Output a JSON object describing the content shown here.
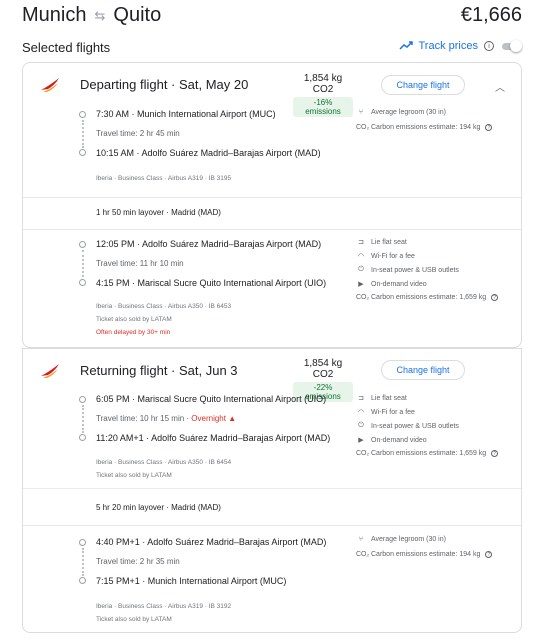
{
  "header": {
    "origin": "Munich",
    "destination": "Quito",
    "swap_icon": "swap-arrows-icon",
    "price": "€1,666"
  },
  "selected_title": "Selected flights",
  "track_prices": {
    "label": "Track prices",
    "info": "i",
    "toggle_on": false
  },
  "colors": {
    "accent": "#1a73e8",
    "logo_red": "#d71920",
    "logo_orange": "#f9a01b",
    "warning": "#d93025",
    "green": "#137333"
  },
  "change_label": "Change flight",
  "departing": {
    "title": "Departing flight · Sat, May 20",
    "co2": "1,854 kg CO2",
    "emissions_badge": "-16% emissions",
    "legs": [
      {
        "dep": "7:30 AM · Munich International Airport (MUC)",
        "travel": "Travel time: 2 hr 45 min",
        "arr": "10:15 AM · Adolfo Suárez Madrid–Barajas Airport (MAD)",
        "details": "Iberia · Business Class · Airbus A319 · IB 3195",
        "amenities": [
          "Average legroom (30 in)",
          "Carbon emissions estimate: 194 kg"
        ]
      },
      {
        "dep": "12:05 PM · Adolfo Suárez Madrid–Barajas Airport (MAD)",
        "travel": "Travel time: 11 hr 10 min",
        "arr": "4:15 PM · Mariscal Sucre Quito International Airport (UIO)",
        "details": "Iberia · Business Class · Airbus A350 · IB 6453",
        "sold_by": "Ticket also sold by LATAM",
        "delay": "Often delayed by 30+ min",
        "amenities": [
          "Lie flat seat",
          "Wi-Fi for a fee",
          "In-seat power & USB outlets",
          "On-demand video",
          "Carbon emissions estimate: 1,659 kg"
        ]
      }
    ],
    "layover": "1 hr 50 min layover · Madrid (MAD)"
  },
  "returning": {
    "title": "Returning flight · Sat, Jun 3",
    "co2": "1,854 kg CO2",
    "emissions_badge": "-22% emissions",
    "legs": [
      {
        "dep": "6:05 PM · Mariscal Sucre Quito International Airport (UIO)",
        "travel": "Travel time: 10 hr 15 min · ",
        "overnight": "Overnight",
        "arr": "11:20 AM+1 · Adolfo Suárez Madrid–Barajas Airport (MAD)",
        "details": "Iberia · Business Class · Airbus A350 · IB 6454",
        "sold_by": "Ticket also sold by LATAM",
        "amenities": [
          "Lie flat seat",
          "Wi-Fi for a fee",
          "In-seat power & USB outlets",
          "On-demand video",
          "Carbon emissions estimate: 1,659 kg"
        ]
      },
      {
        "dep": "4:40 PM+1 · Adolfo Suárez Madrid–Barajas Airport (MAD)",
        "travel": "Travel time: 2 hr 35 min",
        "arr": "7:15 PM+1 · Munich International Airport (MUC)",
        "details": "Iberia · Business Class · Airbus A319 · IB 3192",
        "sold_by": "Ticket also sold by LATAM",
        "amenities": [
          "Average legroom (30 in)",
          "Carbon emissions estimate: 194 kg"
        ]
      }
    ],
    "layover": "5 hr 20 min layover · Madrid (MAD)"
  }
}
